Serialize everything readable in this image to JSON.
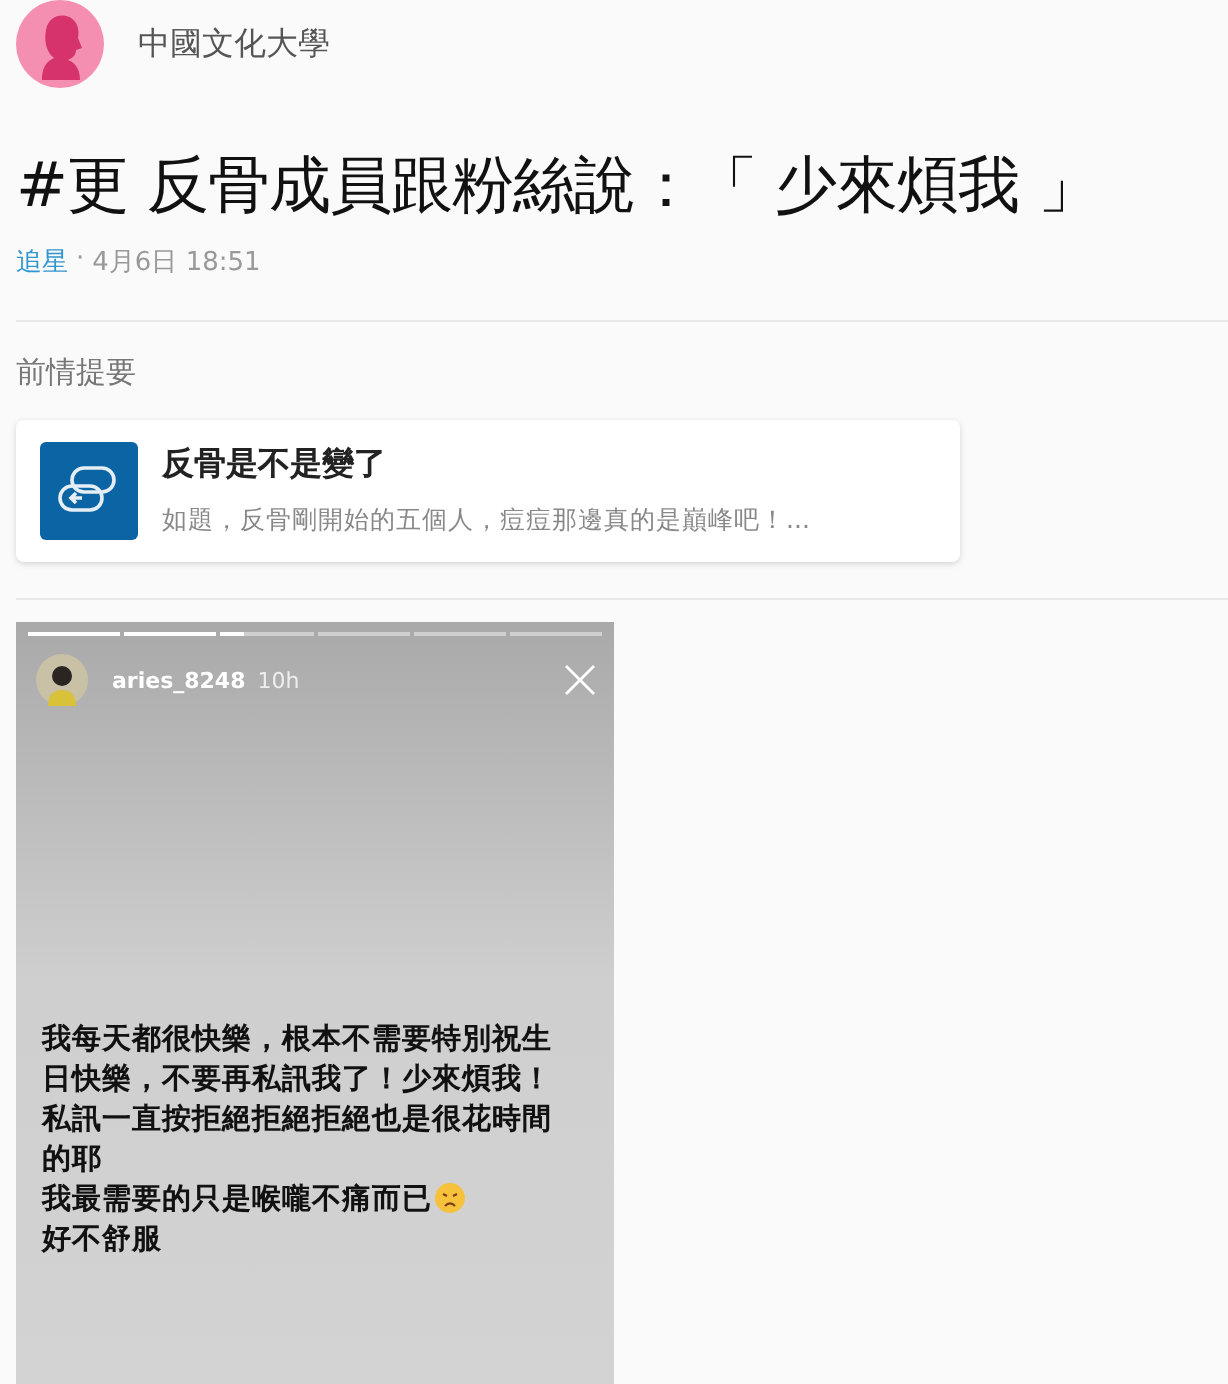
{
  "author": {
    "name": "中國文化大學"
  },
  "post": {
    "title": "#更 反骨成員跟粉絲說：「 少來煩我 」",
    "board": "追星",
    "separator": "·",
    "date": "4月6日 18:51"
  },
  "section_label": "前情提要",
  "link_card": {
    "title": "反骨是不是變了",
    "excerpt": "如題，反骨剛開始的五個人，痘痘那邊真的是巔峰吧！..."
  },
  "story": {
    "segments": [
      {
        "level": 1
      },
      {
        "level": 1
      },
      {
        "level": 0.25
      },
      {
        "level": 0
      },
      {
        "level": 0
      },
      {
        "level": 0
      }
    ],
    "username": "aries_8248",
    "time": "10h",
    "lines": [
      {
        "text": "我每天都很快樂，根本不需要特別祝生",
        "emoji": false
      },
      {
        "text": "日快樂，不要再私訊我了！少來煩我！",
        "emoji": false
      },
      {
        "text": "私訊一直按拒絕拒絕拒絕也是很花時間",
        "emoji": false
      },
      {
        "text": "的耶",
        "emoji": false
      },
      {
        "text": "我最需要的只是喉嚨不痛而已",
        "emoji": true
      },
      {
        "text": "好不舒服",
        "emoji": false
      }
    ]
  }
}
